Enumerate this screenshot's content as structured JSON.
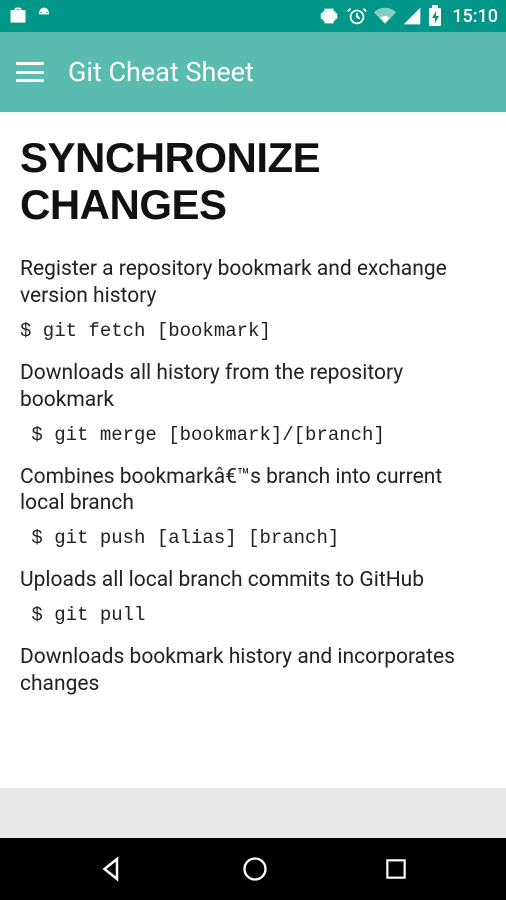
{
  "status": {
    "time": "15:10"
  },
  "header": {
    "title": "Git Cheat Sheet"
  },
  "section": {
    "heading": "SYNCHRONIZE CHANGES",
    "items": [
      {
        "desc": "Register a repository bookmark and exchange version history",
        "cmd": "$ git fetch [bookmark]"
      },
      {
        "desc": "Downloads all history from the repository bookmark",
        "cmd": " $ git merge [bookmark]/[branch]"
      },
      {
        "desc": "Combines bookmarkâ€™s branch into current local branch",
        "cmd": " $ git push [alias] [branch]"
      },
      {
        "desc": "Uploads all local branch commits to GitHub",
        "cmd": " $ git pull"
      },
      {
        "desc": "Downloads bookmark history and incorporates changes",
        "cmd": ""
      }
    ]
  }
}
